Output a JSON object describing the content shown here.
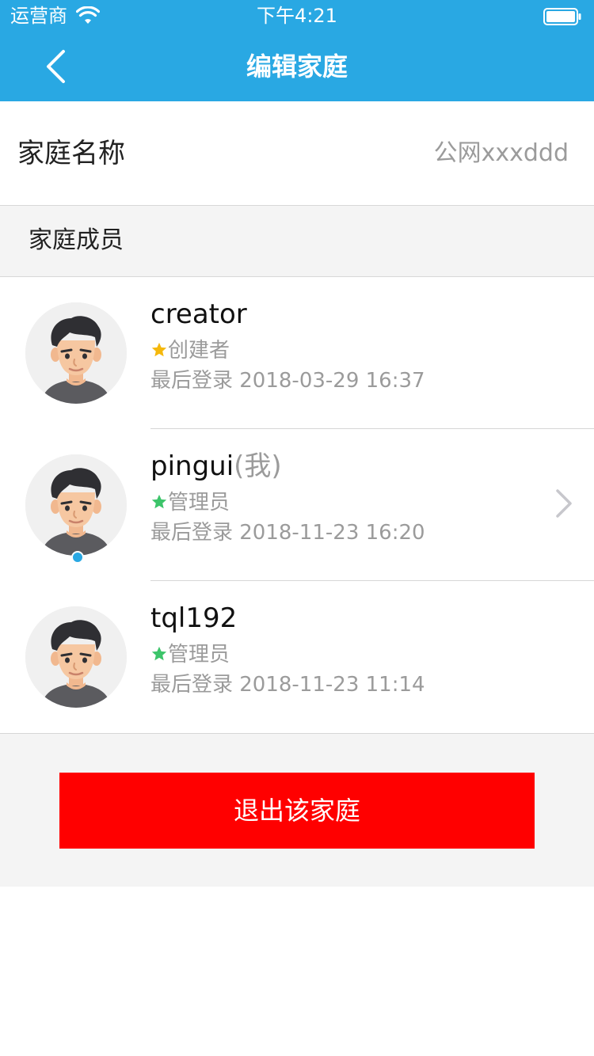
{
  "status_bar": {
    "carrier": "运营商",
    "time": "下午4:21",
    "icons": [
      "wifi-icon",
      "battery-icon"
    ]
  },
  "nav": {
    "title": "编辑家庭",
    "back_icon": "back-arrow-icon"
  },
  "family": {
    "name_label": "家庭名称",
    "name_value": "公网xxxddd"
  },
  "members_section": {
    "title": "家庭成员"
  },
  "members": [
    {
      "name": "creator",
      "me_tag": "",
      "role": "创建者",
      "role_star_color": "#f5b80c",
      "last_login": "最后登录 2018-03-29 16:37",
      "online": false,
      "has_chevron": false
    },
    {
      "name": "pingui",
      "me_tag": "(我)",
      "role": "管理员",
      "role_star_color": "#3cc46a",
      "last_login": "最后登录 2018-11-23 16:20",
      "online": true,
      "has_chevron": true
    },
    {
      "name": "tql192",
      "me_tag": "",
      "role": "管理员",
      "role_star_color": "#3cc46a",
      "last_login": "最后登录 2018-11-23 11:14",
      "online": false,
      "has_chevron": false
    }
  ],
  "actions": {
    "exit_label": "退出该家庭"
  },
  "colors": {
    "header": "#29a8e3",
    "exit_button": "#ff0000",
    "online_dot": "#29a8e3"
  }
}
